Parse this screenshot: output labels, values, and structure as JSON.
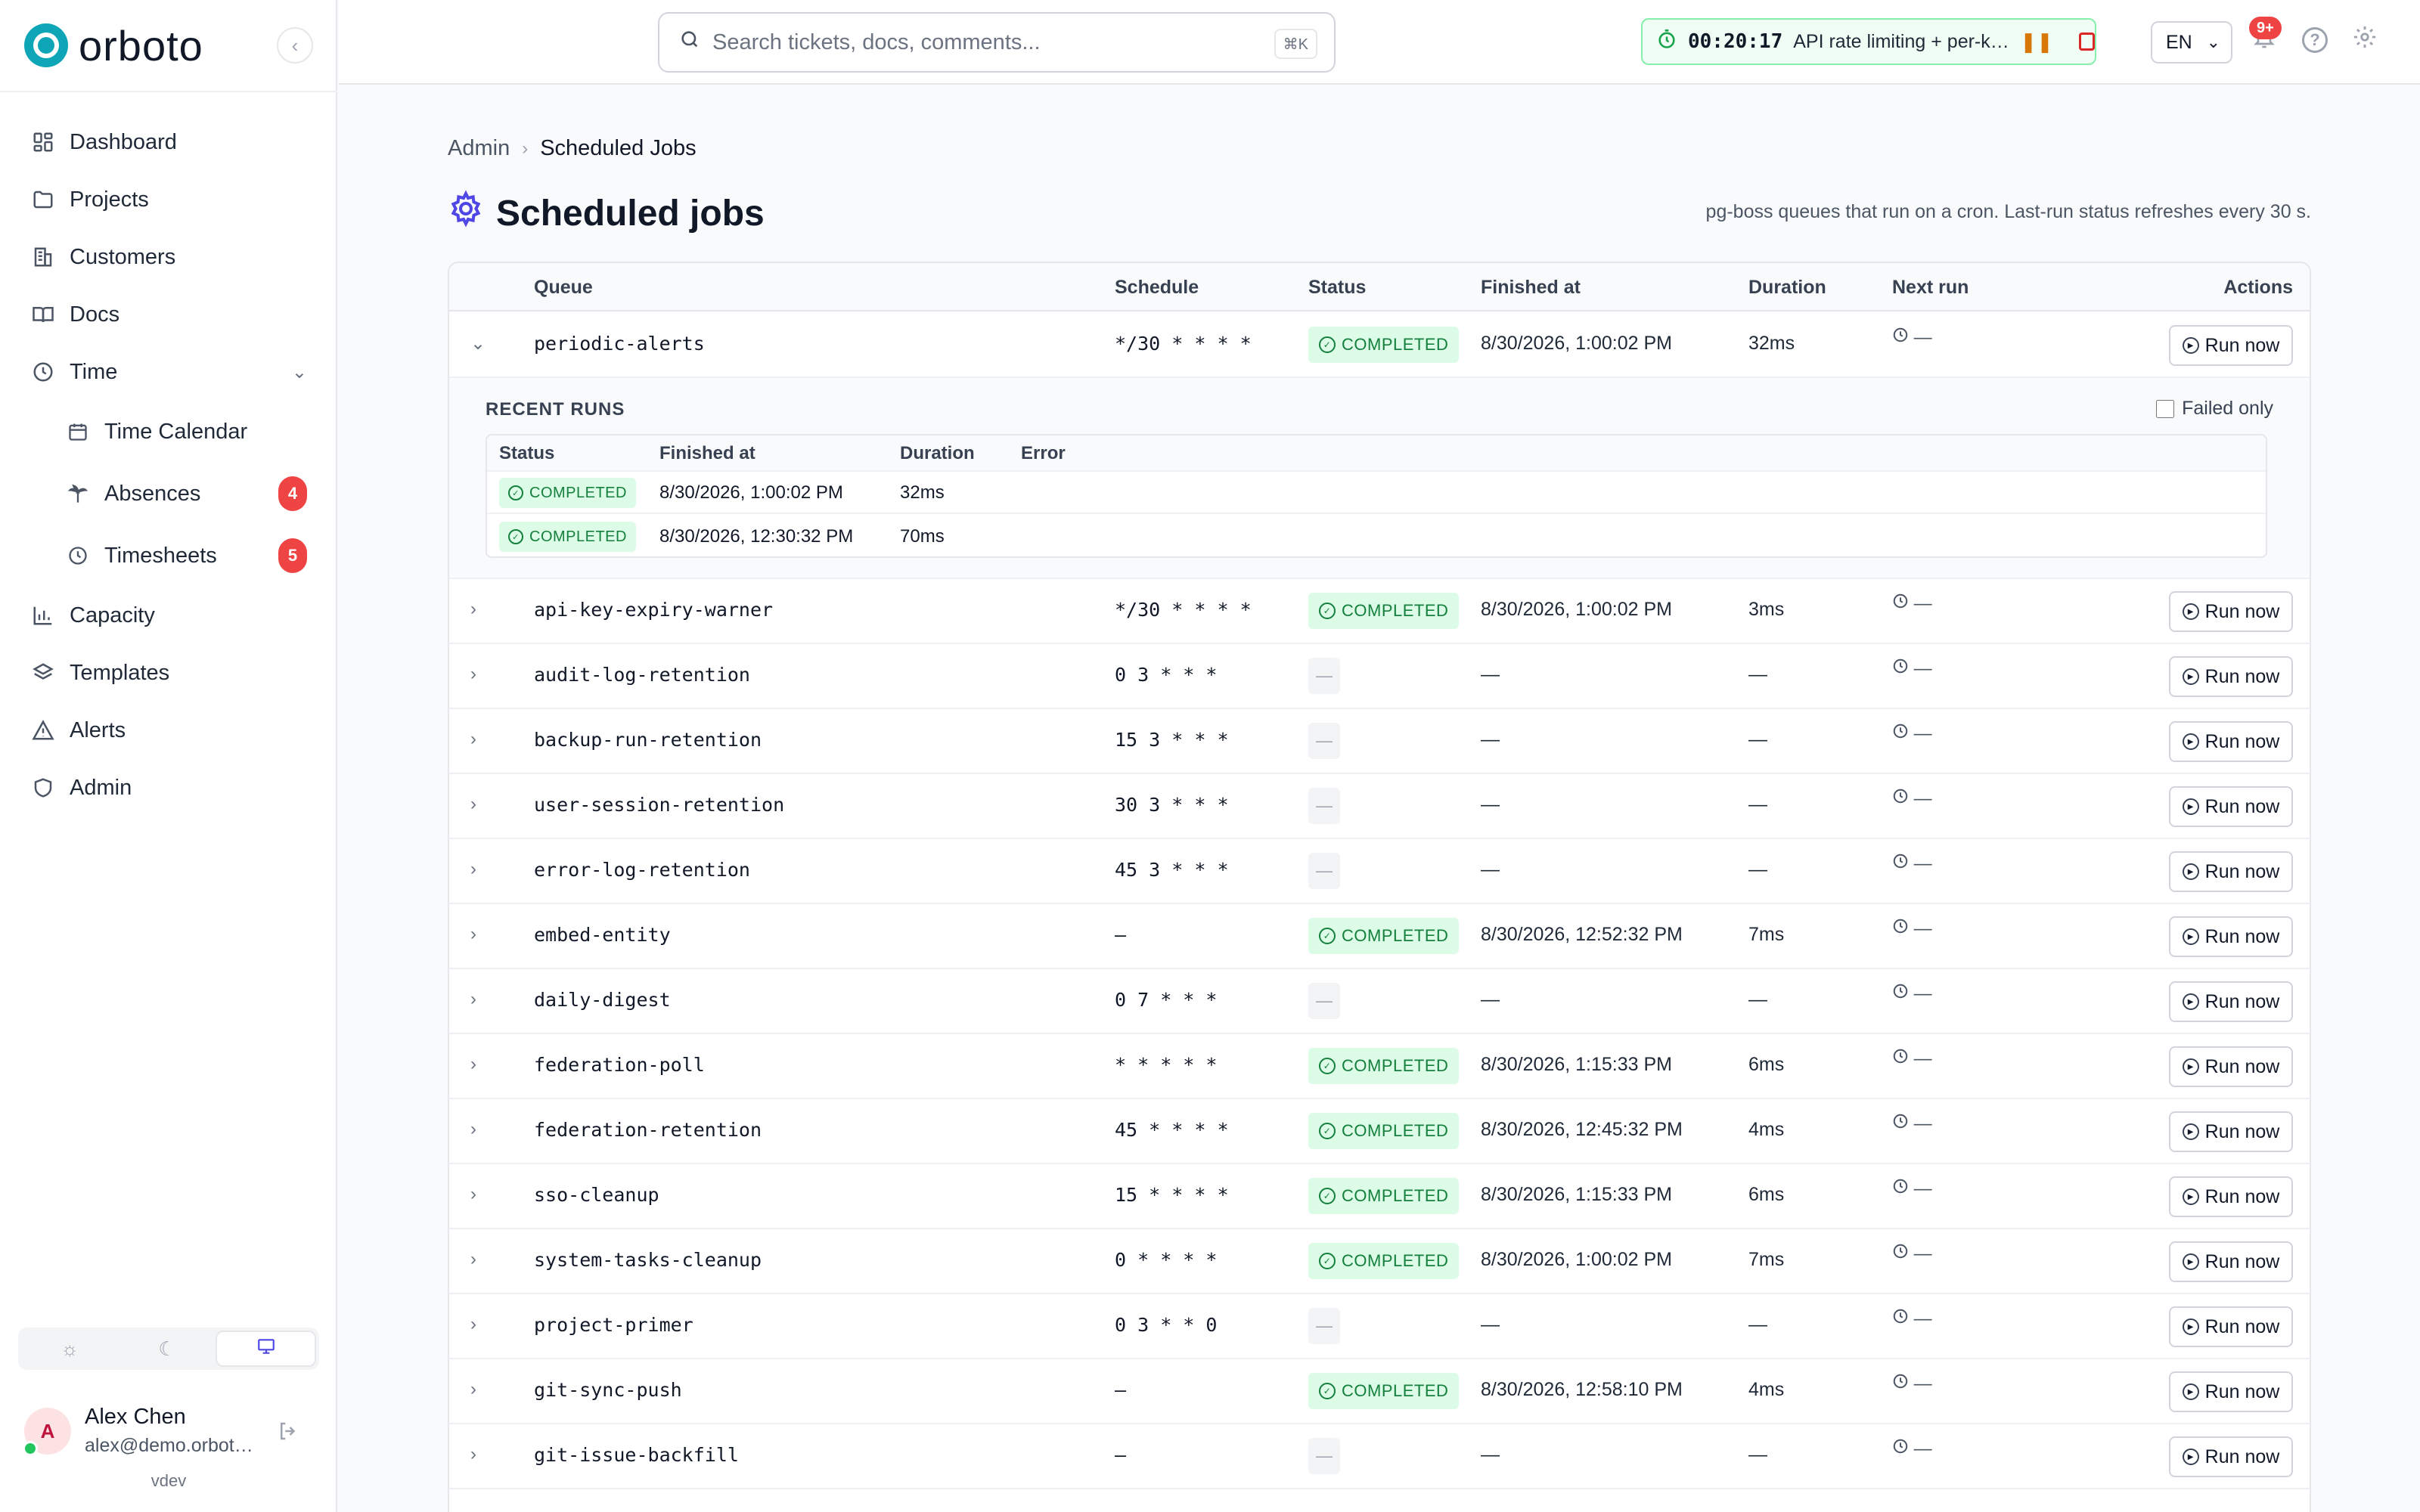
{
  "app": {
    "name": "orboto",
    "version": "vdev"
  },
  "sidebar": {
    "items": [
      {
        "label": "Dashboard",
        "icon": "dashboard-icon"
      },
      {
        "label": "Projects",
        "icon": "folder-icon"
      },
      {
        "label": "Customers",
        "icon": "building-icon"
      },
      {
        "label": "Docs",
        "icon": "book-icon"
      },
      {
        "label": "Time",
        "icon": "clock-icon"
      },
      {
        "label": "Time Calendar",
        "icon": "calendar-icon"
      },
      {
        "label": "Absences",
        "icon": "palm-tree-icon",
        "badge": "4"
      },
      {
        "label": "Timesheets",
        "icon": "clock-icon",
        "badge": "5"
      },
      {
        "label": "Capacity",
        "icon": "bar-chart-icon"
      },
      {
        "label": "Templates",
        "icon": "layers-icon"
      },
      {
        "label": "Alerts",
        "icon": "warning-icon"
      },
      {
        "label": "Admin",
        "icon": "shield-icon"
      }
    ],
    "user": {
      "initial": "A",
      "name": "Alex Chen",
      "email": "alex@demo.orboto.io"
    }
  },
  "topbar": {
    "search_placeholder": "Search tickets, docs, comments...",
    "search_shortcut": "⌘K",
    "timer": {
      "time": "00:20:17",
      "label": "API rate limiting + per-key quotas"
    },
    "language": "EN",
    "notifications_badge": "9+"
  },
  "breadcrumb": {
    "parent": "Admin",
    "current": "Scheduled Jobs"
  },
  "page": {
    "title": "Scheduled jobs",
    "subtitle": "pg-boss queues that run on a cron. Last-run status refreshes every 30 s."
  },
  "table": {
    "headers": {
      "queue": "Queue",
      "schedule": "Schedule",
      "status": "Status",
      "finished": "Finished at",
      "duration": "Duration",
      "next": "Next run",
      "actions": "Actions"
    },
    "run_label": "Run now",
    "completed_label": "COMPLETED",
    "dash": "—",
    "rows": [
      {
        "queue": "periodic-alerts",
        "schedule": "*/30 * * * *",
        "status": "COMPLETED",
        "finished": "8/30/2026, 1:00:02 PM",
        "duration": "32ms",
        "next": "—",
        "expanded": true
      },
      {
        "queue": "api-key-expiry-warner",
        "schedule": "*/30 * * * *",
        "status": "COMPLETED",
        "finished": "8/30/2026, 1:00:02 PM",
        "duration": "3ms",
        "next": "—"
      },
      {
        "queue": "audit-log-retention",
        "schedule": "0 3 * * *",
        "status": "—",
        "finished": "—",
        "duration": "—",
        "next": "—"
      },
      {
        "queue": "backup-run-retention",
        "schedule": "15 3 * * *",
        "status": "—",
        "finished": "—",
        "duration": "—",
        "next": "—"
      },
      {
        "queue": "user-session-retention",
        "schedule": "30 3 * * *",
        "status": "—",
        "finished": "—",
        "duration": "—",
        "next": "—"
      },
      {
        "queue": "error-log-retention",
        "schedule": "45 3 * * *",
        "status": "—",
        "finished": "—",
        "duration": "—",
        "next": "—"
      },
      {
        "queue": "embed-entity",
        "schedule": "—",
        "status": "COMPLETED",
        "finished": "8/30/2026, 12:52:32 PM",
        "duration": "7ms",
        "next": "—"
      },
      {
        "queue": "daily-digest",
        "schedule": "0 7 * * *",
        "status": "—",
        "finished": "—",
        "duration": "—",
        "next": "—"
      },
      {
        "queue": "federation-poll",
        "schedule": "* * * * *",
        "status": "COMPLETED",
        "finished": "8/30/2026, 1:15:33 PM",
        "duration": "6ms",
        "next": "—"
      },
      {
        "queue": "federation-retention",
        "schedule": "45 * * * *",
        "status": "COMPLETED",
        "finished": "8/30/2026, 12:45:32 PM",
        "duration": "4ms",
        "next": "—"
      },
      {
        "queue": "sso-cleanup",
        "schedule": "15 * * * *",
        "status": "COMPLETED",
        "finished": "8/30/2026, 1:15:33 PM",
        "duration": "6ms",
        "next": "—"
      },
      {
        "queue": "system-tasks-cleanup",
        "schedule": "0 * * * *",
        "status": "COMPLETED",
        "finished": "8/30/2026, 1:00:02 PM",
        "duration": "7ms",
        "next": "—"
      },
      {
        "queue": "project-primer",
        "schedule": "0 3 * * 0",
        "status": "—",
        "finished": "—",
        "duration": "—",
        "next": "—"
      },
      {
        "queue": "git-sync-push",
        "schedule": "—",
        "status": "COMPLETED",
        "finished": "8/30/2026, 12:58:10 PM",
        "duration": "4ms",
        "next": "—"
      },
      {
        "queue": "git-issue-backfill",
        "schedule": "—",
        "status": "—",
        "finished": "—",
        "duration": "—",
        "next": "—"
      }
    ]
  },
  "recent_runs": {
    "title": "RECENT RUNS",
    "failed_only_label": "Failed only",
    "headers": {
      "status": "Status",
      "finished": "Finished at",
      "duration": "Duration",
      "error": "Error"
    },
    "rows": [
      {
        "status": "COMPLETED",
        "finished": "8/30/2026, 1:00:02 PM",
        "duration": "32ms"
      },
      {
        "status": "COMPLETED",
        "finished": "8/30/2026, 12:30:32 PM",
        "duration": "70ms"
      }
    ]
  }
}
